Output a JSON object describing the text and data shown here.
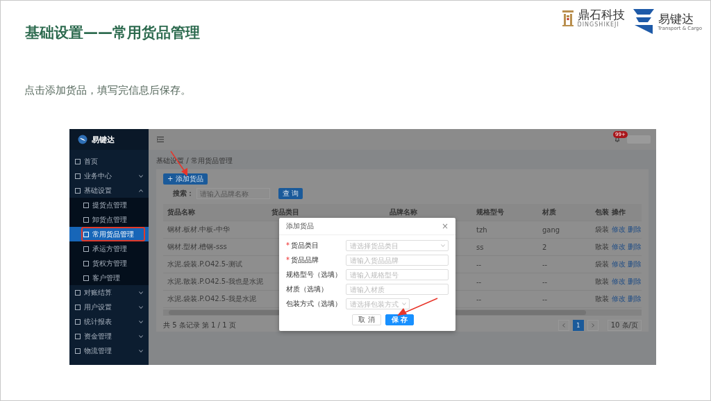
{
  "slide": {
    "title": "基础设置——常用货品管理",
    "instruction": "点击添加货品，填写完信息后保存。",
    "logos": [
      {
        "name": "鼎石科技",
        "sub": "DINGSHIKEJI"
      },
      {
        "name": "易键达",
        "sub": "Transport & Cargo"
      }
    ]
  },
  "app": {
    "brand": "易键达",
    "sidebar": {
      "items": [
        {
          "label": "首页",
          "selected": false
        },
        {
          "label": "业务中心",
          "selected": false,
          "expanded": false
        },
        {
          "label": "基础设置",
          "selected": false,
          "expanded": true,
          "children": [
            {
              "label": "提货点管理",
              "selected": false
            },
            {
              "label": "卸货点管理",
              "selected": false
            },
            {
              "label": "常用货品管理",
              "selected": true
            },
            {
              "label": "承运方管理",
              "selected": false
            },
            {
              "label": "货权方管理",
              "selected": false
            },
            {
              "label": "客户管理",
              "selected": false
            }
          ]
        },
        {
          "label": "对账结算",
          "selected": false,
          "expanded": false
        },
        {
          "label": "用户设置",
          "selected": false,
          "expanded": false
        },
        {
          "label": "统计报表",
          "selected": false,
          "expanded": false
        },
        {
          "label": "资金管理",
          "selected": false,
          "expanded": false
        },
        {
          "label": "物流管理",
          "selected": false,
          "expanded": false
        }
      ]
    },
    "header": {
      "badge": "99+"
    },
    "breadcrumb": "基础设置 / 常用货品管理",
    "add_button": "+ 添加货品",
    "search": {
      "label": "搜索：",
      "placeholder": "请输入品牌名称",
      "button": "查 询"
    },
    "table": {
      "columns": [
        "货品名称",
        "货品类目",
        "品牌名称",
        "规格型号",
        "材质",
        "包装",
        "操作"
      ],
      "rows": [
        {
          "name": "钢材.板材.中板-中华",
          "spec": "tzh",
          "material": "gang",
          "packing": "袋装",
          "actions": [
            "修改",
            "删除"
          ]
        },
        {
          "name": "钢材.型材.槽钢-sss",
          "spec": "ss",
          "material": "2",
          "packing": "散装",
          "actions": [
            "修改",
            "删除"
          ]
        },
        {
          "name": "水泥.袋装.P.O42.5-测试",
          "spec": "--",
          "material": "--",
          "packing": "袋装",
          "actions": [
            "修改",
            "删除"
          ]
        },
        {
          "name": "水泥.散装.P.O42.5-我也是水泥",
          "spec": "--",
          "material": "--",
          "packing": "散装",
          "actions": [
            "修改",
            "删除"
          ]
        },
        {
          "name": "水泥.袋装.P.O42.5-我是水泥",
          "spec": "--",
          "material": "--",
          "packing": "散装",
          "actions": [
            "修改",
            "删除"
          ]
        }
      ]
    },
    "summary": "共 5 条记录 第 1 / 1 页",
    "pagination": {
      "pages": [
        {
          "label": "1",
          "selected": true
        }
      ],
      "page_size": "10 条/页"
    },
    "dialog": {
      "title": "添加货品",
      "close": "×",
      "fields": [
        {
          "label": "货品类目",
          "required": true,
          "kind": "select",
          "placeholder": "请选择货品类目"
        },
        {
          "label": "货品品牌",
          "required": true,
          "kind": "input",
          "placeholder": "请输入货品品牌"
        },
        {
          "label": "规格型号（选填）",
          "required": false,
          "kind": "input",
          "placeholder": "请输入规格型号"
        },
        {
          "label": "材质（选填）",
          "required": false,
          "kind": "input",
          "placeholder": "请输入材质"
        },
        {
          "label": "包装方式（选填）",
          "required": false,
          "kind": "select-short",
          "placeholder": "请选择包装方式"
        }
      ],
      "required_mark": "*",
      "cancel": "取 消",
      "save": "保 存"
    }
  }
}
